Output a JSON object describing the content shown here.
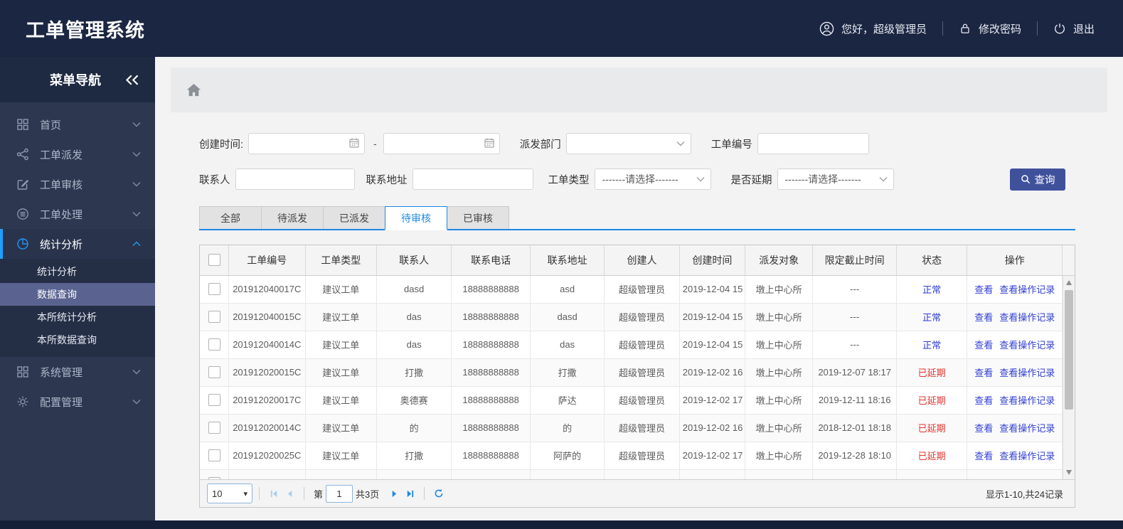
{
  "header": {
    "title": "工单管理系统",
    "user_greeting": "您好，超级管理员",
    "change_password": "修改密码",
    "logout": "退出"
  },
  "sidebar": {
    "nav_title": "菜单导航",
    "items": [
      {
        "label": "首页",
        "icon": "grid-icon",
        "active": false,
        "expanded": false
      },
      {
        "label": "工单派发",
        "icon": "share-icon",
        "active": false,
        "expanded": false
      },
      {
        "label": "工单审核",
        "icon": "edit-icon",
        "active": false,
        "expanded": false
      },
      {
        "label": "工单处理",
        "icon": "process-icon",
        "active": false,
        "expanded": false
      },
      {
        "label": "统计分析",
        "icon": "pie-chart-icon",
        "active": true,
        "expanded": true,
        "children": [
          {
            "label": "统计分析",
            "active": false
          },
          {
            "label": "数据查询",
            "active": true
          },
          {
            "label": "本所统计分析",
            "active": false
          },
          {
            "label": "本所数据查询",
            "active": false
          }
        ]
      },
      {
        "label": "系统管理",
        "icon": "grid-icon",
        "active": false,
        "expanded": false
      },
      {
        "label": "配置管理",
        "icon": "gear-icon",
        "active": false,
        "expanded": false
      }
    ]
  },
  "filters": {
    "create_time_label": "创建时间:",
    "date_separator": "-",
    "dispatch_dept_label": "派发部门",
    "order_no_label": "工单编号",
    "contact_label": "联系人",
    "contact_address_label": "联系地址",
    "order_type_label": "工单类型",
    "order_type_placeholder": "-------请选择-------",
    "is_delayed_label": "是否延期",
    "is_delayed_placeholder": "-------请选择-------",
    "search_button": "查询"
  },
  "tabs": [
    {
      "label": "全部",
      "active": false
    },
    {
      "label": "待派发",
      "active": false
    },
    {
      "label": "已派发",
      "active": false
    },
    {
      "label": "待审核",
      "active": true
    },
    {
      "label": "已审核",
      "active": false
    }
  ],
  "table": {
    "columns": [
      "工单编号",
      "工单类型",
      "联系人",
      "联系电话",
      "联系地址",
      "创建人",
      "创建时间",
      "派发对象",
      "限定截止时间",
      "状态",
      "操作"
    ],
    "action_labels": {
      "view": "查看",
      "view_log": "查看操作记录"
    },
    "rows": [
      {
        "order_no": "201912040017C",
        "type": "建议工单",
        "contact": "dasd",
        "phone": "18888888888",
        "address": "asd",
        "creator": "超级管理员",
        "created": "2019-12-04 15",
        "target": "墩上中心所",
        "deadline": "---",
        "status": "正常",
        "status_type": "normal",
        "actions": true
      },
      {
        "order_no": "201912040015C",
        "type": "建议工单",
        "contact": "das",
        "phone": "18888888888",
        "address": "dasd",
        "creator": "超级管理员",
        "created": "2019-12-04 15",
        "target": "墩上中心所",
        "deadline": "---",
        "status": "正常",
        "status_type": "normal",
        "actions": true
      },
      {
        "order_no": "201912040014C",
        "type": "建议工单",
        "contact": "das",
        "phone": "18888888888",
        "address": "das",
        "creator": "超级管理员",
        "created": "2019-12-04 15",
        "target": "墩上中心所",
        "deadline": "---",
        "status": "正常",
        "status_type": "normal",
        "actions": true
      },
      {
        "order_no": "201912020015C",
        "type": "建议工单",
        "contact": "打撒",
        "phone": "18888888888",
        "address": "打撒",
        "creator": "超级管理员",
        "created": "2019-12-02 16",
        "target": "墩上中心所",
        "deadline": "2019-12-07 18:17",
        "status": "已延期",
        "status_type": "delayed",
        "actions": true
      },
      {
        "order_no": "201912020017C",
        "type": "建议工单",
        "contact": "奥德赛",
        "phone": "18888888888",
        "address": "萨达",
        "creator": "超级管理员",
        "created": "2019-12-02 17",
        "target": "墩上中心所",
        "deadline": "2019-12-11 18:16",
        "status": "已延期",
        "status_type": "delayed",
        "actions": true
      },
      {
        "order_no": "201912020014C",
        "type": "建议工单",
        "contact": "的",
        "phone": "18888888888",
        "address": "的",
        "creator": "超级管理员",
        "created": "2019-12-02 16",
        "target": "墩上中心所",
        "deadline": "2018-12-01 18:18",
        "status": "已延期",
        "status_type": "delayed",
        "actions": true
      },
      {
        "order_no": "201912020025C",
        "type": "建议工单",
        "contact": "打撒",
        "phone": "18888888888",
        "address": "阿萨的",
        "creator": "超级管理员",
        "created": "2019-12-02 17",
        "target": "墩上中心所",
        "deadline": "2019-12-28 18:10",
        "status": "已延期",
        "status_type": "delayed",
        "actions": true
      },
      {
        "order_no": "",
        "type": "",
        "contact": "",
        "phone": "",
        "address": "",
        "creator": "",
        "created": "",
        "target": "",
        "deadline": "",
        "status": "",
        "status_type": "normal",
        "actions": false
      }
    ]
  },
  "pagination": {
    "page_size": "10",
    "page_prefix": "第",
    "current_page": "1",
    "total_pages": "共3页",
    "summary": "显示1-10,共24记录"
  },
  "colors": {
    "header_bg": "#1b2642",
    "sidebar_bg": "#2d3850",
    "accent_blue": "#1e88e5",
    "menu_active_blue": "#2196f3",
    "query_button_bg": "#40519c",
    "status_normal": "#2b3cd4",
    "status_delayed": "#e0342e",
    "link_blue": "#3140d4"
  }
}
